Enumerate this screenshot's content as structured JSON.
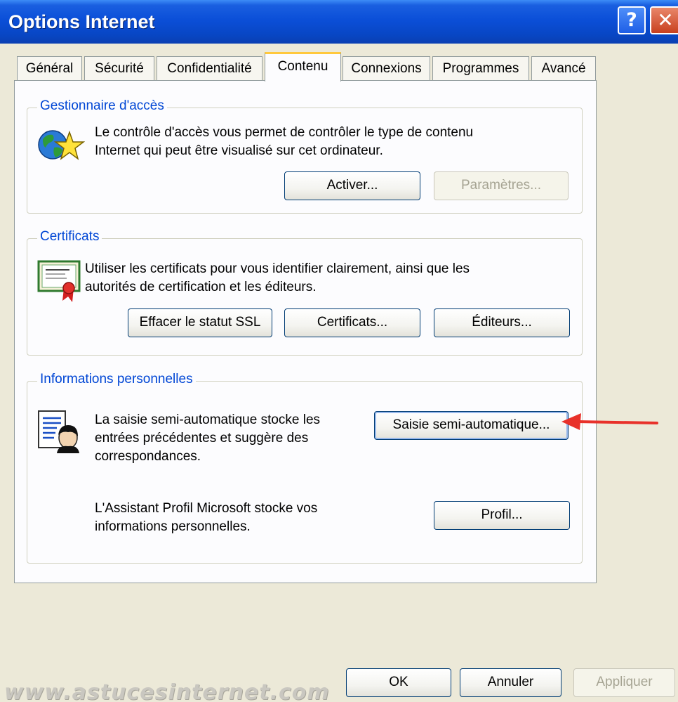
{
  "window": {
    "title": "Options Internet",
    "help_glyph": "?",
    "close_glyph": "✕"
  },
  "tabs": [
    {
      "label": "Général",
      "active": false
    },
    {
      "label": "Sécurité",
      "active": false
    },
    {
      "label": "Confidentialité",
      "active": false
    },
    {
      "label": "Contenu",
      "active": true
    },
    {
      "label": "Connexions",
      "active": false
    },
    {
      "label": "Programmes",
      "active": false
    },
    {
      "label": "Avancé",
      "active": false
    }
  ],
  "content_advisor": {
    "title": "Gestionnaire d'accès",
    "icon": "globe-star-icon",
    "description_line1": "Le contrôle d'accès vous permet de contrôler le type de contenu",
    "description_line2": "Internet qui peut être visualisé sur cet ordinateur.",
    "enable_button": "Activer...",
    "settings_button": "Paramètres..."
  },
  "certificates": {
    "title": "Certificats",
    "icon": "certificate-icon",
    "description_line1": "Utiliser les certificats pour vous identifier clairement, ainsi que les",
    "description_line2": "autorités de certification et les éditeurs.",
    "clear_ssl_button": "Effacer le statut SSL",
    "certificates_button": "Certificats...",
    "publishers_button": "Éditeurs..."
  },
  "personal_info": {
    "title": "Informations personnelles",
    "icon": "person-document-icon",
    "autocomplete_line1": "La saisie semi-automatique stocke les",
    "autocomplete_line2": "entrées précédentes et suggère des",
    "autocomplete_line3": "correspondances.",
    "autocomplete_button": "Saisie semi-automatique...",
    "profile_line1": "L'Assistant Profil Microsoft stocke vos",
    "profile_line2": "informations personnelles.",
    "profile_button": "Profil..."
  },
  "footer": {
    "ok": "OK",
    "cancel": "Annuler",
    "apply": "Appliquer"
  },
  "watermark": "www.astucesinternet.com",
  "colors": {
    "group_title": "#0046d5",
    "arrow": "#e8312a",
    "titlebar": "#0b4fd8"
  }
}
